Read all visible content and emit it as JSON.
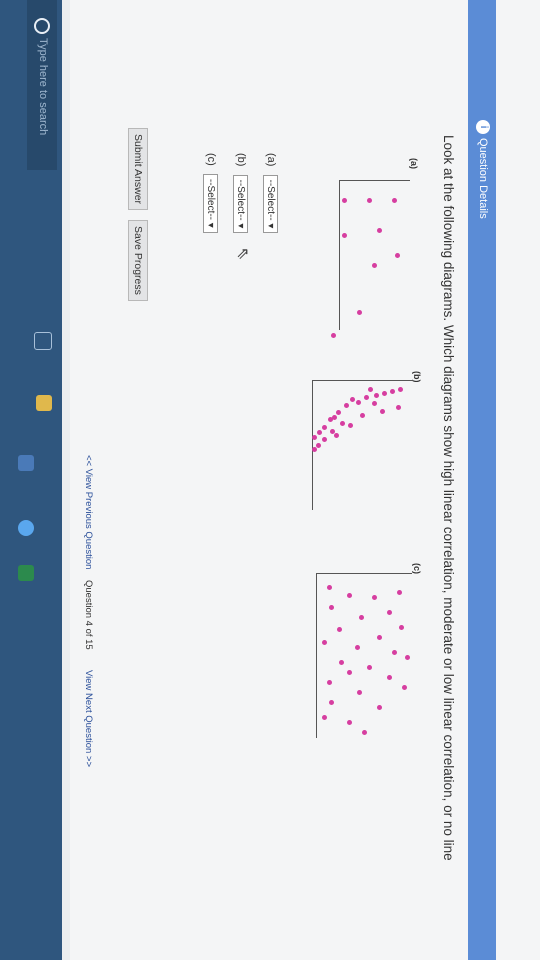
{
  "header": {
    "title": "Question Details"
  },
  "question": {
    "text": "Look at the following diagrams. Which diagrams show high linear correlation, moderate or low linear correlation, or no line"
  },
  "plots": [
    {
      "label": "(a)"
    },
    {
      "label": "(b)"
    },
    {
      "label": "(c)"
    }
  ],
  "answers": [
    {
      "prefix": "(a)",
      "value": "--Select-- ▾"
    },
    {
      "prefix": "(b)",
      "value": "--Select-- ▾"
    },
    {
      "prefix": "(c)",
      "value": "--Select-- ▾"
    }
  ],
  "buttons": {
    "submit": "Submit Answer",
    "save": "Save Progress"
  },
  "nav": {
    "prev": "<< View Previous Question",
    "position": "Question 4 of 15",
    "next": "View Next Question >>"
  },
  "taskbar": {
    "search_placeholder": "Type here to search"
  },
  "colors": {
    "accent": "#5b8cd6",
    "dots": "#d63ea0",
    "taskbar": "#2f567e"
  }
}
